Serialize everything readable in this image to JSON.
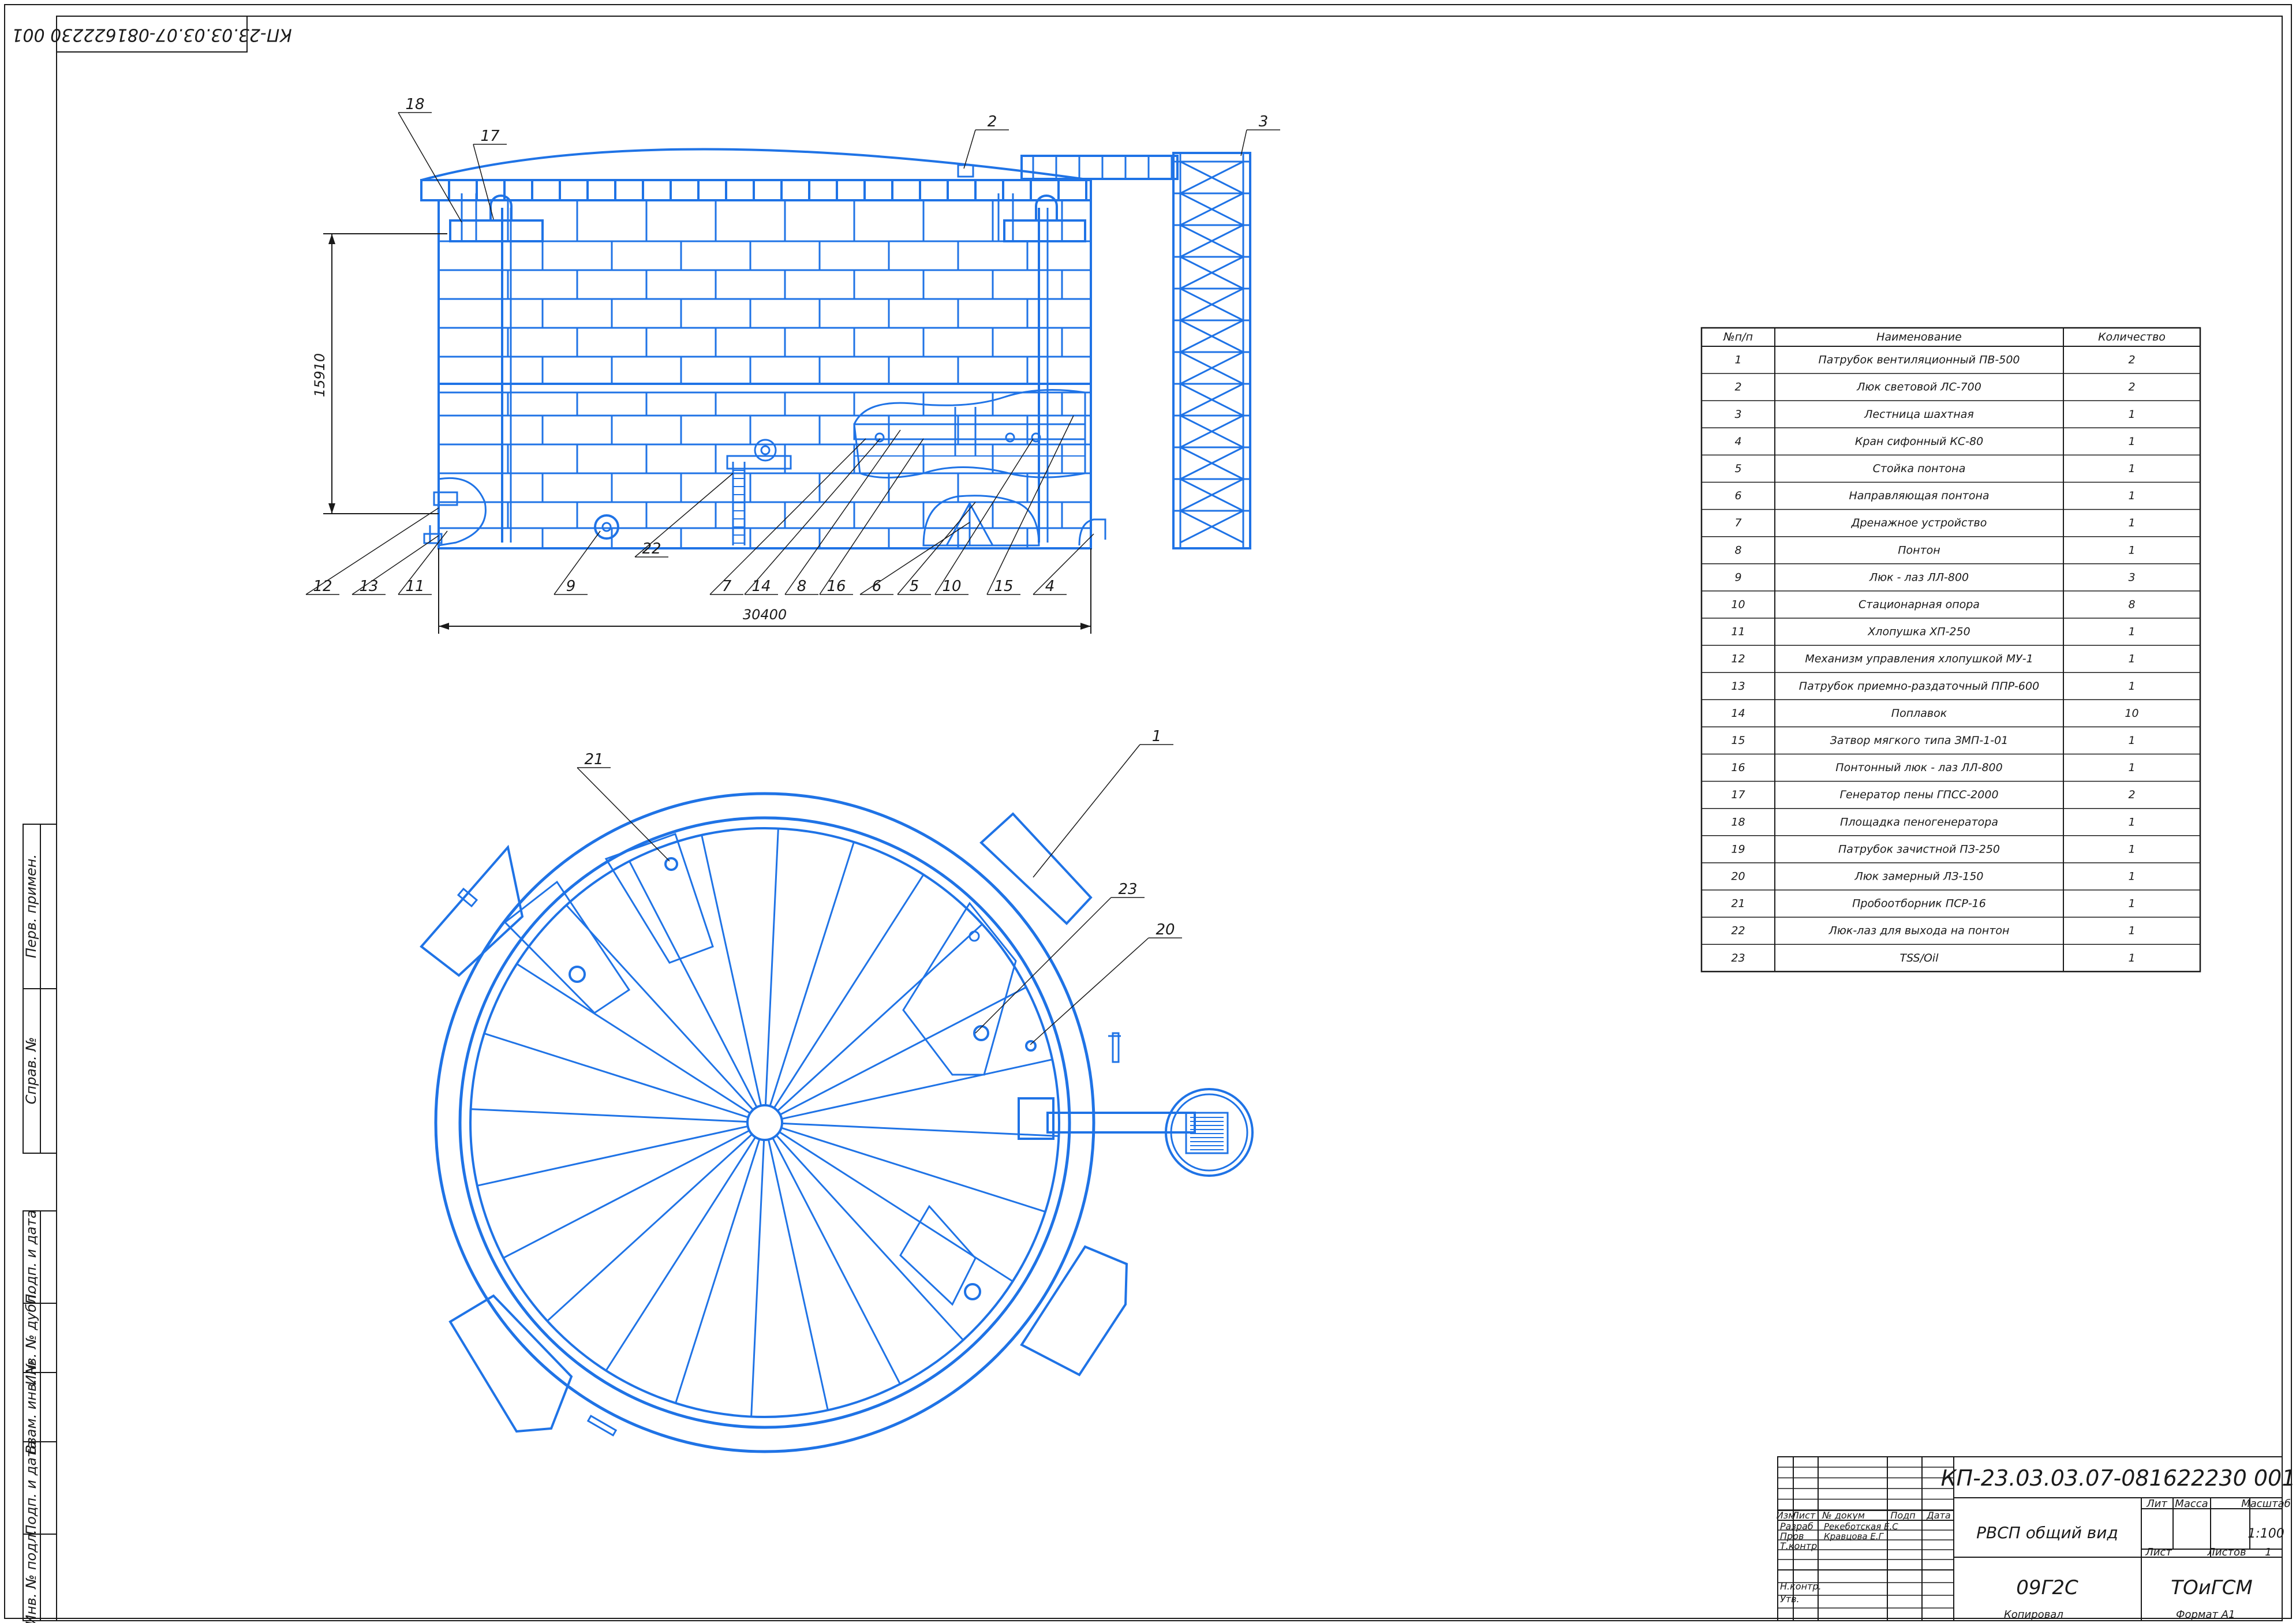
{
  "stamp": {
    "designation": "КП-23.03.03.07-081622230 001",
    "designation_rotated": "КП-23.03.03.07-081622230 001",
    "title": "РВСП общий вид",
    "material": "09Г2С",
    "organization": "ТОиГСМ",
    "scale": "1:100",
    "sheet_no": "1",
    "headers": {
      "lit": "Лит",
      "massa": "Масса",
      "masshtab": "Масштаб",
      "list": "Лист",
      "listov": "Листов"
    },
    "cols": {
      "izm": "Изм",
      "list": "Лист",
      "ndokum": "№ докум",
      "podp": "Подп",
      "data": "Дата"
    },
    "roles": [
      {
        "role": "Разраб",
        "name": "Рекеботская Е.С"
      },
      {
        "role": "Пров",
        "name": "Кравцова Е.Г"
      },
      {
        "role": "Т.контр",
        "name": ""
      },
      {
        "role": "Н.контр.",
        "name": ""
      },
      {
        "role": "Утв.",
        "name": ""
      }
    ],
    "kopiroval": "Копировал",
    "format": "Формат  А1"
  },
  "side_strip": [
    "Перв. примен.",
    "Справ. №",
    "Подп. и дата",
    "Инв. № дубл.",
    "Взам. инв. №",
    "Подп. и дата",
    "Инв. № подл."
  ],
  "dimensions": {
    "height": "15910",
    "width": "30400"
  },
  "callouts_front": [
    "18",
    "17",
    "2",
    "3",
    "12",
    "13",
    "11",
    "9",
    "22",
    "7",
    "14",
    "8",
    "16",
    "6",
    "5",
    "10",
    "15",
    "4"
  ],
  "callouts_plan": [
    "21",
    "1",
    "23",
    "20"
  ],
  "spec": {
    "headers": [
      "№п/п",
      "Наименование",
      "Количество"
    ],
    "rows": [
      [
        "1",
        "Патрубок вентиляционный ПВ-500",
        "2"
      ],
      [
        "2",
        "Люк световой ЛС-700",
        "2"
      ],
      [
        "3",
        "Лестница шахтная",
        "1"
      ],
      [
        "4",
        "Кран сифонный КС-80",
        "1"
      ],
      [
        "5",
        "Стойка понтона",
        "1"
      ],
      [
        "6",
        "Направляющая понтона",
        "1"
      ],
      [
        "7",
        "Дренажное устройство",
        "1"
      ],
      [
        "8",
        "Понтон",
        "1"
      ],
      [
        "9",
        "Люк - лаз ЛЛ-800",
        "3"
      ],
      [
        "10",
        "Стационарная опора",
        "8"
      ],
      [
        "11",
        "Хлопушка ХП-250",
        "1"
      ],
      [
        "12",
        "Механизм управления хлопушкой МУ-1",
        "1"
      ],
      [
        "13",
        "Патрубок приемно-раздаточный ППР-600",
        "1"
      ],
      [
        "14",
        "Поплавок",
        "10"
      ],
      [
        "15",
        "Затвор мягкого типа ЗМП-1-01",
        "1"
      ],
      [
        "16",
        "Понтонный люк - лаз ЛЛ-800",
        "1"
      ],
      [
        "17",
        "Генератор пены ГПСС-2000",
        "2"
      ],
      [
        "18",
        "Площадка пеногенератора",
        "1"
      ],
      [
        "19",
        "Патрубок зачистной ПЗ-250",
        "1"
      ],
      [
        "20",
        "Люк замерный ЛЗ-150",
        "1"
      ],
      [
        "21",
        "Пробоотборник ПСР-16",
        "1"
      ],
      [
        "22",
        "Люк-лаз для выхода на понтон",
        "1"
      ],
      [
        "23",
        "TSS/Oil",
        "1"
      ]
    ]
  }
}
